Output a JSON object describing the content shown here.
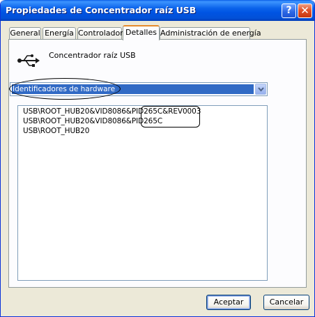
{
  "window": {
    "title": "Propiedades de Concentrador raíz USB",
    "help_label": "?",
    "close_label": "✕"
  },
  "tabs": [
    {
      "label": "General"
    },
    {
      "label": "Energía"
    },
    {
      "label": "Controlador"
    },
    {
      "label": "Detalles",
      "active": true
    },
    {
      "label": "Administración de energía"
    }
  ],
  "device": {
    "icon": "usb-icon",
    "name": "Concentrador raíz USB"
  },
  "property_select": {
    "selected": "Identificadores de hardware"
  },
  "values_list": [
    "USB\\ROOT_HUB20&VID8086&PID265C&REV0003",
    "USB\\ROOT_HUB20&VID8086&PID265C",
    "USB\\ROOT_HUB20"
  ],
  "buttons": {
    "ok": "Aceptar",
    "cancel": "Cancelar"
  },
  "colors": {
    "titlebar": "#0054e3",
    "selection": "#316ac5",
    "active_tab_accent": "#e68b2c",
    "dialog_bg": "#ece9d8"
  }
}
